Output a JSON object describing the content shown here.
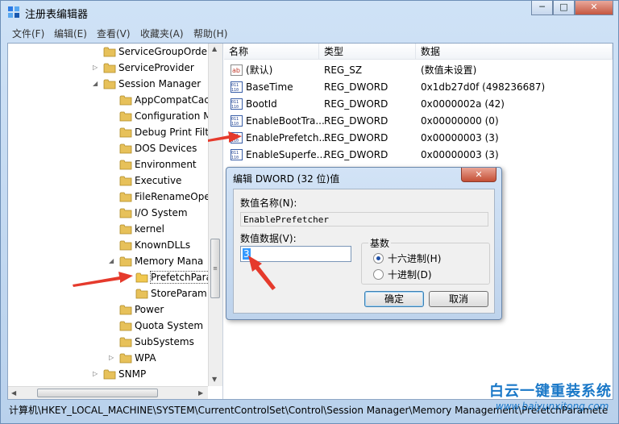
{
  "window": {
    "title": "注册表编辑器",
    "controls": {
      "minimize": "─",
      "maximize": "□",
      "close": "✕"
    }
  },
  "menu": [
    "文件(F)",
    "编辑(E)",
    "查看(V)",
    "收藏夹(A)",
    "帮助(H)"
  ],
  "tree": {
    "items": [
      {
        "label": "ServiceGroupOrde",
        "level": 0,
        "expander": ""
      },
      {
        "label": "ServiceProvider",
        "level": 0,
        "expander": "▷"
      },
      {
        "label": "Session Manager",
        "level": 0,
        "expander": "◢"
      },
      {
        "label": "AppCompatCac",
        "level": 1,
        "expander": ""
      },
      {
        "label": "Configuration M",
        "level": 1,
        "expander": ""
      },
      {
        "label": "Debug Print Filt",
        "level": 1,
        "expander": ""
      },
      {
        "label": "DOS Devices",
        "level": 1,
        "expander": ""
      },
      {
        "label": "Environment",
        "level": 1,
        "expander": ""
      },
      {
        "label": "Executive",
        "level": 1,
        "expander": ""
      },
      {
        "label": "FileRenameOpe",
        "level": 1,
        "expander": ""
      },
      {
        "label": "I/O System",
        "level": 1,
        "expander": ""
      },
      {
        "label": "kernel",
        "level": 1,
        "expander": ""
      },
      {
        "label": "KnownDLLs",
        "level": 1,
        "expander": ""
      },
      {
        "label": "Memory Mana",
        "level": 1,
        "expander": "◢"
      },
      {
        "label": "PrefetchPara",
        "level": 2,
        "expander": ""
      },
      {
        "label": "StoreParam",
        "level": 2,
        "expander": ""
      },
      {
        "label": "Power",
        "level": 1,
        "expander": ""
      },
      {
        "label": "Quota System",
        "level": 1,
        "expander": ""
      },
      {
        "label": "SubSystems",
        "level": 1,
        "expander": ""
      },
      {
        "label": "WPA",
        "level": 1,
        "expander": "▷"
      },
      {
        "label": "SNMP",
        "level": 0,
        "expander": "▷"
      }
    ]
  },
  "values": {
    "headers": {
      "name": "名称",
      "type": "类型",
      "data": "数据"
    },
    "rows": [
      {
        "name": "(默认)",
        "type": "REG_SZ",
        "data": "(数值未设置)",
        "icon": "string-value-icon"
      },
      {
        "name": "BaseTime",
        "type": "REG_DWORD",
        "data": "0x1db27d0f (498236687)",
        "icon": "binary-value-icon"
      },
      {
        "name": "BootId",
        "type": "REG_DWORD",
        "data": "0x0000002a (42)",
        "icon": "binary-value-icon"
      },
      {
        "name": "EnableBootTra...",
        "type": "REG_DWORD",
        "data": "0x00000000 (0)",
        "icon": "binary-value-icon"
      },
      {
        "name": "EnablePrefetch...",
        "type": "REG_DWORD",
        "data": "0x00000003 (3)",
        "icon": "binary-value-icon"
      },
      {
        "name": "EnableSuperfe...",
        "type": "REG_DWORD",
        "data": "0x00000003 (3)",
        "icon": "binary-value-icon"
      }
    ]
  },
  "dialog": {
    "title": "编辑 DWORD (32 位)值",
    "close": "✕",
    "name_label": "数值名称(N):",
    "name_value": "EnablePrefetcher",
    "data_label": "数值数据(V):",
    "data_value": "3",
    "base_label": "基数",
    "radio_hex": "十六进制(H)",
    "radio_dec": "十进制(D)",
    "ok": "确定",
    "cancel": "取消"
  },
  "status": "计算机\\HKEY_LOCAL_MACHINE\\SYSTEM\\CurrentControlSet\\Control\\Session Manager\\Memory Management\\PrefetchParamete",
  "watermark": {
    "title": "白云一键重装系统",
    "url": "www.baiyunxitong.com"
  },
  "colors": {
    "accent_red": "#e53a2c",
    "watermark_blue": "#1a78c8",
    "folder": "#e7c15a"
  }
}
